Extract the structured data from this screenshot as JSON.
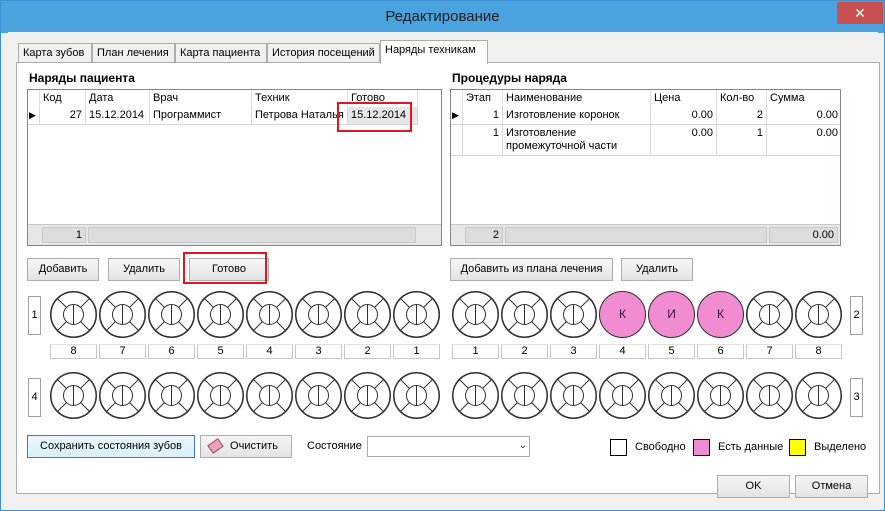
{
  "window": {
    "title": "Редактирование",
    "close_glyph": "✕"
  },
  "tabs": [
    {
      "label": "Карта зубов"
    },
    {
      "label": "План лечения"
    },
    {
      "label": "Карта пациента"
    },
    {
      "label": "История посещений"
    },
    {
      "label": "Наряды техникам"
    }
  ],
  "orders": {
    "title": "Наряды пациента",
    "columns": [
      "Код",
      "Дата",
      "Врач",
      "Техник",
      "Готово"
    ],
    "rows": [
      {
        "code": "27",
        "date": "15.12.2014",
        "doctor": "Программист",
        "tech": "Петрова Наталья",
        "ready": "15.12.2014"
      }
    ],
    "footer_count": "1",
    "row_marker": "▶"
  },
  "procedures": {
    "title": "Процедуры наряда",
    "columns": [
      "Этап",
      "Наименование",
      "Цена",
      "Кол-во",
      "Сумма"
    ],
    "rows": [
      {
        "stage": "1",
        "name": "Изготовление коронок",
        "price": "0.00",
        "qty": "2",
        "sum": "0.00"
      },
      {
        "stage": "1",
        "name": "Изготовление промежуточной части",
        "price": "0.00",
        "qty": "1",
        "sum": "0.00"
      }
    ],
    "footer_count": "2",
    "footer_sum": "0.00",
    "row_marker": "▶"
  },
  "buttons": {
    "add": "Добавить",
    "delete": "Удалить",
    "ready": "Готово",
    "add_from_plan": "Добавить из плана лечения",
    "delete2": "Удалить",
    "save_states": "Сохранить состояния зубов",
    "clear": "Очистить",
    "ok": "OK",
    "cancel": "Отмена"
  },
  "quadrants": {
    "q1": "1",
    "q2": "2",
    "q3": "3",
    "q4": "4"
  },
  "tooth_numbers_left": [
    "8",
    "7",
    "6",
    "5",
    "4",
    "3",
    "2",
    "1"
  ],
  "tooth_numbers_right": [
    "1",
    "2",
    "3",
    "4",
    "5",
    "6",
    "7",
    "8"
  ],
  "upper_right_marks": [
    "",
    "",
    "",
    "К",
    "И",
    "К",
    "",
    ""
  ],
  "state": {
    "label": "Состояние",
    "value": ""
  },
  "legend": [
    {
      "label": "Свободно",
      "color": "#ffffff"
    },
    {
      "label": "Есть данные",
      "color": "#f18bd2"
    },
    {
      "label": "Выделено",
      "color": "#ffff00"
    }
  ]
}
